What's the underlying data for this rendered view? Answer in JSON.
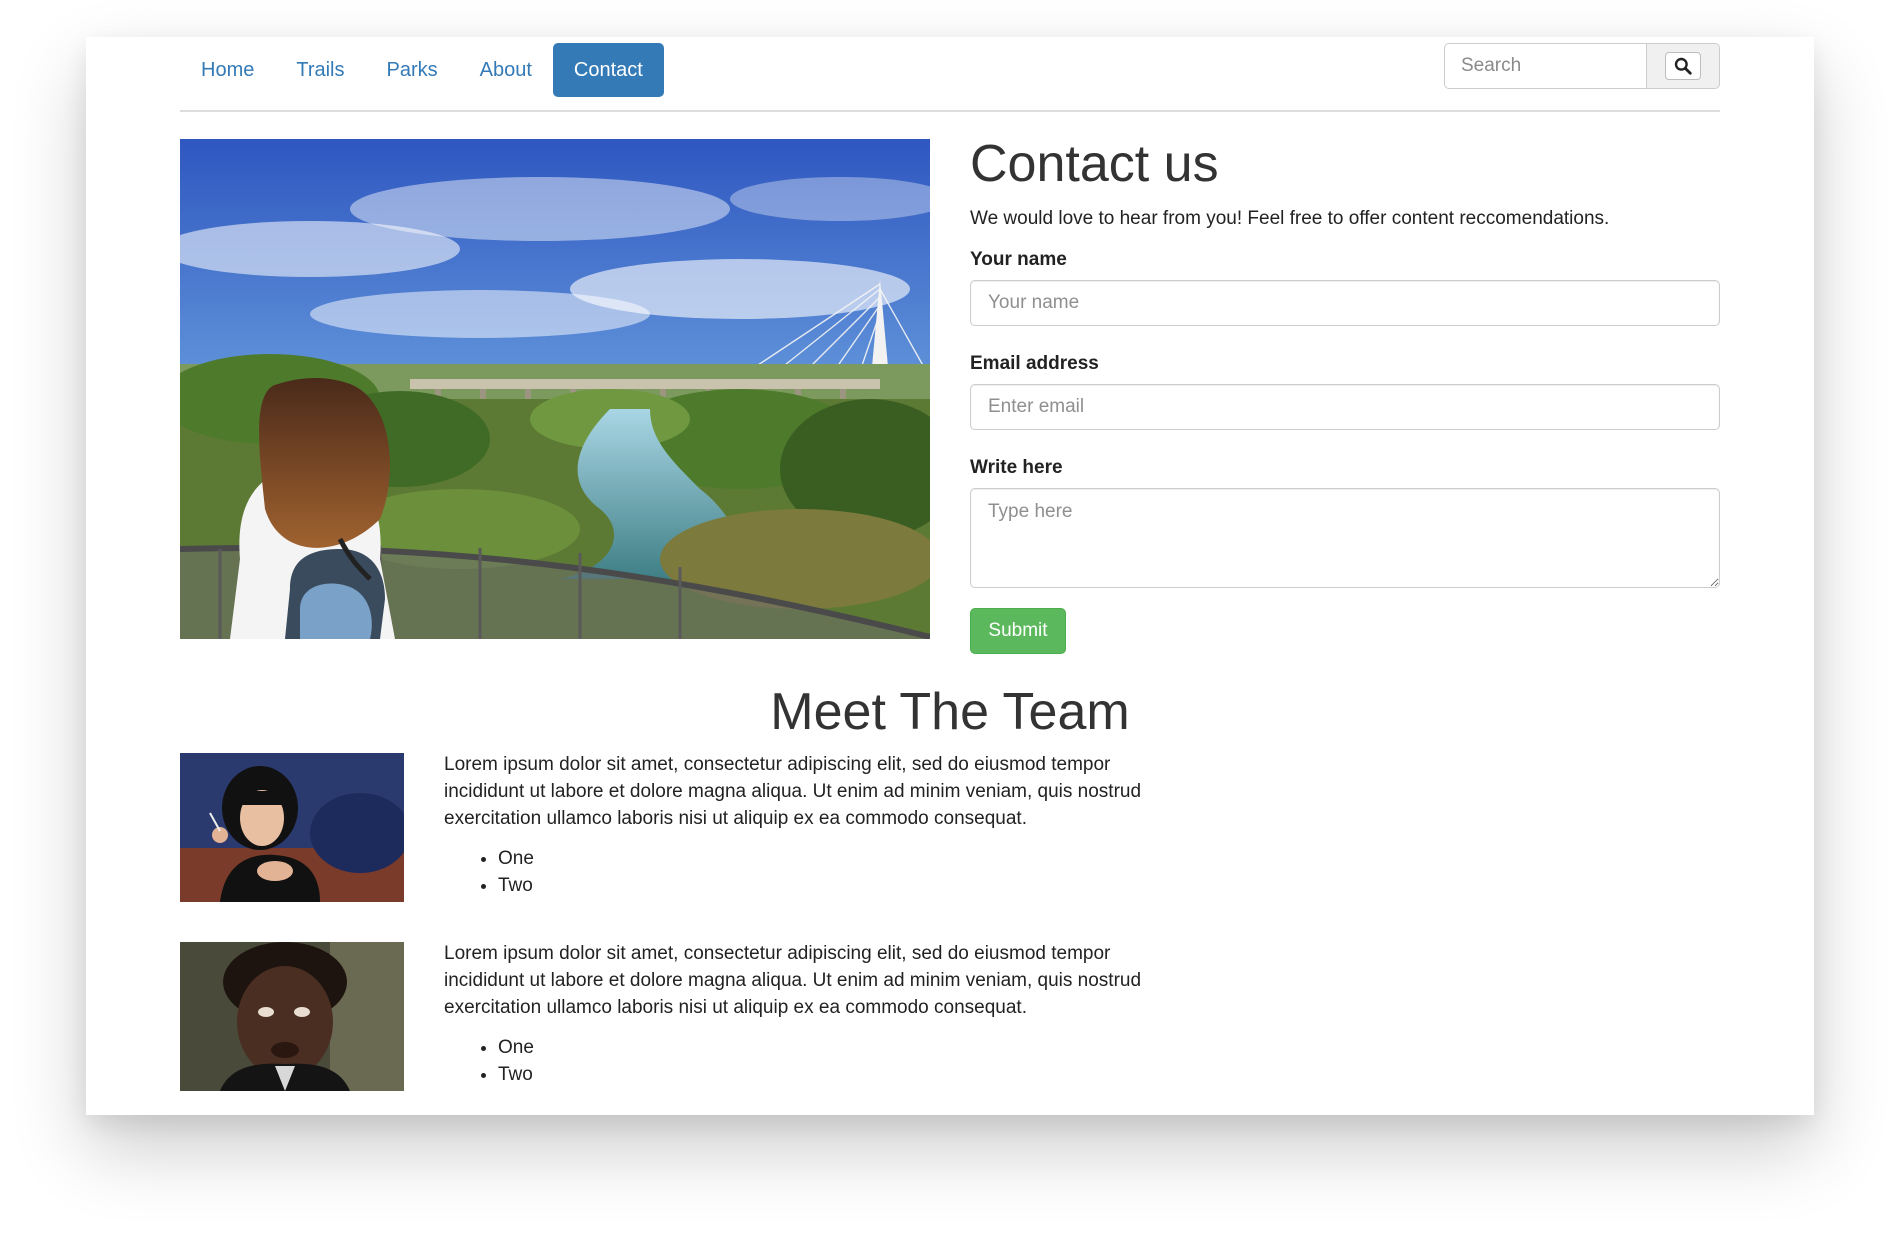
{
  "nav": {
    "items": [
      {
        "label": "Home"
      },
      {
        "label": "Trails"
      },
      {
        "label": "Parks"
      },
      {
        "label": "About"
      },
      {
        "label": "Contact"
      }
    ],
    "active_item": "Contact",
    "search_placeholder": "Search",
    "search_icon": "search-icon"
  },
  "contact": {
    "title": "Contact us",
    "lead": "We would love to hear from you! Feel free to offer content reccomendations.",
    "name_label": "Your name",
    "name_placeholder": "Your name",
    "email_label": "Email address",
    "email_placeholder": "Enter email",
    "message_label": "Write here",
    "message_placeholder": "Type here",
    "submit_label": "Submit"
  },
  "team": {
    "title": "Meet The Team",
    "members": [
      {
        "bio": "Lorem ipsum dolor sit amet, consectetur adipiscing elit, sed do eiusmod tempor incididunt ut labore et dolore magna aliqua. Ut enim ad minim veniam, quis nostrud exercitation ullamco laboris nisi ut aliquip ex ea commodo consequat.",
        "list": [
          "One",
          "Two"
        ]
      },
      {
        "bio": "Lorem ipsum dolor sit amet, consectetur adipiscing elit, sed do eiusmod tempor incididunt ut labore et dolore magna aliqua. Ut enim ad minim veniam, quis nostrud exercitation ullamco laboris nisi ut aliquip ex ea commodo consequat.",
        "list": [
          "One",
          "Two"
        ]
      }
    ]
  },
  "colors": {
    "link": "#337ab7",
    "active_nav_bg": "#337ab7",
    "submit_bg": "#5cb85c",
    "text": "#333333"
  }
}
